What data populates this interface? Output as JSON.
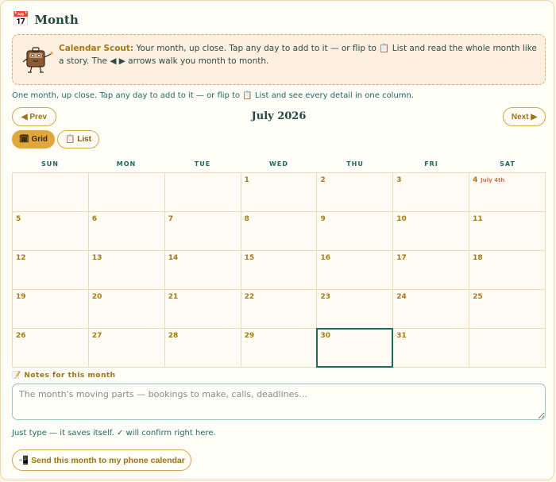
{
  "header": {
    "icon": "calendar-icon",
    "title": "Month"
  },
  "scout": {
    "name": "Calendar Scout:",
    "message": "Your month, up close. Tap any day to add to it — or flip to 📋 List and read the whole month like a story. The ◀ ▶ arrows walk you month to month."
  },
  "intro": "One month, up close. Tap any day to add to it — or flip to 📋 List and see every detail in one column.",
  "nav": {
    "prev_label": "◀ Prev",
    "next_label": "Next ▶",
    "month_label": "July 2026"
  },
  "view": {
    "grid_label": "🗓 Grid",
    "list_label": "📋 List",
    "selected": "grid"
  },
  "calendar": {
    "days_of_week": [
      "SUN",
      "MON",
      "TUE",
      "WED",
      "THU",
      "FRI",
      "SAT"
    ],
    "weeks": [
      [
        {
          "day": ""
        },
        {
          "day": ""
        },
        {
          "day": ""
        },
        {
          "day": "1"
        },
        {
          "day": "2"
        },
        {
          "day": "3"
        },
        {
          "day": "4",
          "event": "July 4th"
        }
      ],
      [
        {
          "day": "5"
        },
        {
          "day": "6"
        },
        {
          "day": "7"
        },
        {
          "day": "8"
        },
        {
          "day": "9"
        },
        {
          "day": "10"
        },
        {
          "day": "11"
        }
      ],
      [
        {
          "day": "12"
        },
        {
          "day": "13"
        },
        {
          "day": "14"
        },
        {
          "day": "15"
        },
        {
          "day": "16"
        },
        {
          "day": "17"
        },
        {
          "day": "18"
        }
      ],
      [
        {
          "day": "19"
        },
        {
          "day": "20"
        },
        {
          "day": "21"
        },
        {
          "day": "22"
        },
        {
          "day": "23"
        },
        {
          "day": "24"
        },
        {
          "day": "25"
        }
      ],
      [
        {
          "day": "26"
        },
        {
          "day": "27"
        },
        {
          "day": "28"
        },
        {
          "day": "29"
        },
        {
          "day": "30",
          "today": true
        },
        {
          "day": "31"
        },
        {
          "day": ""
        }
      ]
    ]
  },
  "notes": {
    "label": "📝 Notes for this month",
    "placeholder": "The month's moving parts — bookings to make, calls, deadlines…",
    "hint": "Just type — it saves itself. ✓ will confirm right here."
  },
  "send_label": "📲 Send this month to my phone calendar",
  "colors": {
    "accent": "#e0a83a",
    "teal": "#1f6b5c",
    "gold_text": "#a67a10",
    "event": "#d2774a"
  }
}
